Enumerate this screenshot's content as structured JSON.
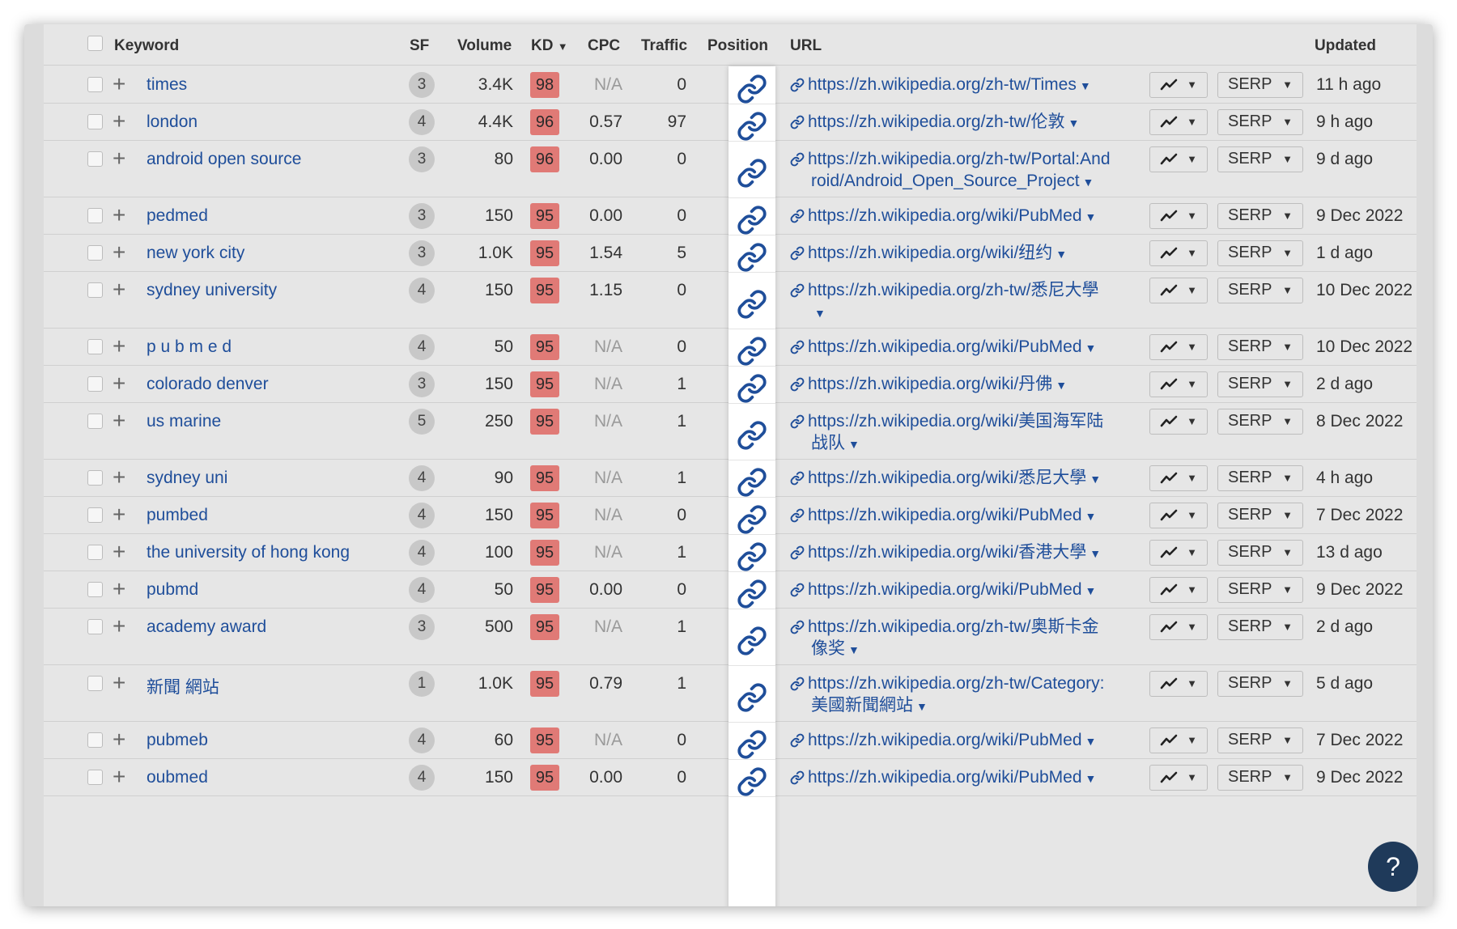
{
  "headers": {
    "keyword": "Keyword",
    "sf": "SF",
    "volume": "Volume",
    "kd": "KD",
    "cpc": "CPC",
    "traffic": "Traffic",
    "position": "Position",
    "url": "URL",
    "updated": "Updated"
  },
  "colors": {
    "kd_badge": "#e07a76",
    "link": "#1f4e9a",
    "help_button": "#1f3a5a"
  },
  "buttons": {
    "serp_label": "SERP"
  },
  "help_label": "?",
  "rows": [
    {
      "keyword": "times",
      "sf": "3",
      "volume": "3.4K",
      "kd": "98",
      "cpc": "N/A",
      "traffic": "0",
      "url": "https://zh.wikipedia.org/zh-tw/Times",
      "url_line1": "https://zh.wikipedia.org/zh-tw/Times",
      "url_line2": "",
      "updated": "11 h ago"
    },
    {
      "keyword": "london",
      "sf": "4",
      "volume": "4.4K",
      "kd": "96",
      "cpc": "0.57",
      "traffic": "97",
      "url": "https://zh.wikipedia.org/zh-tw/伦敦",
      "url_line1": "https://zh.wikipedia.org/zh-tw/伦敦",
      "url_line2": "",
      "updated": "9 h ago"
    },
    {
      "keyword": "android open source",
      "sf": "3",
      "volume": "80",
      "kd": "96",
      "cpc": "0.00",
      "traffic": "0",
      "url": "https://zh.wikipedia.org/zh-tw/Portal:Android/Android_Open_Source_Project",
      "url_line1": "https://zh.wikipedia.org/zh-tw/Portal:And",
      "url_line2": "roid/Android_Open_Source_Project",
      "updated": "9 d ago"
    },
    {
      "keyword": "pedmed",
      "sf": "3",
      "volume": "150",
      "kd": "95",
      "cpc": "0.00",
      "traffic": "0",
      "url": "https://zh.wikipedia.org/wiki/PubMed",
      "url_line1": "https://zh.wikipedia.org/wiki/PubMed",
      "url_line2": "",
      "updated": "9 Dec 2022"
    },
    {
      "keyword": "new york city",
      "sf": "3",
      "volume": "1.0K",
      "kd": "95",
      "cpc": "1.54",
      "traffic": "5",
      "url": "https://zh.wikipedia.org/wiki/纽约",
      "url_line1": "https://zh.wikipedia.org/wiki/纽约",
      "url_line2": "",
      "updated": "1 d ago"
    },
    {
      "keyword": "sydney university",
      "sf": "4",
      "volume": "150",
      "kd": "95",
      "cpc": "1.15",
      "traffic": "0",
      "url": "https://zh.wikipedia.org/zh-tw/悉尼大學",
      "url_line1": "https://zh.wikipedia.org/zh-tw/悉尼大學",
      "url_line2": "",
      "updated": "10 Dec 2022"
    },
    {
      "keyword": "p u b m e d",
      "sf": "4",
      "volume": "50",
      "kd": "95",
      "cpc": "N/A",
      "traffic": "0",
      "url": "https://zh.wikipedia.org/wiki/PubMed",
      "url_line1": "https://zh.wikipedia.org/wiki/PubMed",
      "url_line2": "",
      "updated": "10 Dec 2022"
    },
    {
      "keyword": "colorado denver",
      "sf": "3",
      "volume": "150",
      "kd": "95",
      "cpc": "N/A",
      "traffic": "1",
      "url": "https://zh.wikipedia.org/wiki/丹佛",
      "url_line1": "https://zh.wikipedia.org/wiki/丹佛",
      "url_line2": "",
      "updated": "2 d ago"
    },
    {
      "keyword": "us marine",
      "sf": "5",
      "volume": "250",
      "kd": "95",
      "cpc": "N/A",
      "traffic": "1",
      "url": "https://zh.wikipedia.org/wiki/美国海军陆战队",
      "url_line1": "https://zh.wikipedia.org/wiki/美国海军陆",
      "url_line2": "战队",
      "updated": "8 Dec 2022"
    },
    {
      "keyword": "sydney uni",
      "sf": "4",
      "volume": "90",
      "kd": "95",
      "cpc": "N/A",
      "traffic": "1",
      "url": "https://zh.wikipedia.org/wiki/悉尼大學",
      "url_line1": "https://zh.wikipedia.org/wiki/悉尼大學",
      "url_line2": "",
      "updated": "4 h ago"
    },
    {
      "keyword": "pumbed",
      "sf": "4",
      "volume": "150",
      "kd": "95",
      "cpc": "N/A",
      "traffic": "0",
      "url": "https://zh.wikipedia.org/wiki/PubMed",
      "url_line1": "https://zh.wikipedia.org/wiki/PubMed",
      "url_line2": "",
      "updated": "7 Dec 2022"
    },
    {
      "keyword": "the university of hong kong",
      "sf": "4",
      "volume": "100",
      "kd": "95",
      "cpc": "N/A",
      "traffic": "1",
      "url": "https://zh.wikipedia.org/wiki/香港大學",
      "url_line1": "https://zh.wikipedia.org/wiki/香港大學",
      "url_line2": "",
      "updated": "13 d ago"
    },
    {
      "keyword": "pubmd",
      "sf": "4",
      "volume": "50",
      "kd": "95",
      "cpc": "0.00",
      "traffic": "0",
      "url": "https://zh.wikipedia.org/wiki/PubMed",
      "url_line1": "https://zh.wikipedia.org/wiki/PubMed",
      "url_line2": "",
      "updated": "9 Dec 2022"
    },
    {
      "keyword": "academy award",
      "sf": "3",
      "volume": "500",
      "kd": "95",
      "cpc": "N/A",
      "traffic": "1",
      "url": "https://zh.wikipedia.org/zh-tw/奥斯卡金像奖",
      "url_line1": "https://zh.wikipedia.org/zh-tw/奥斯卡金",
      "url_line2": "像奖",
      "updated": "2 d ago"
    },
    {
      "keyword": "新聞 網站",
      "sf": "1",
      "volume": "1.0K",
      "kd": "95",
      "cpc": "0.79",
      "traffic": "1",
      "url": "https://zh.wikipedia.org/zh-tw/Category:美國新聞網站",
      "url_line1": "https://zh.wikipedia.org/zh-tw/Category:",
      "url_line2": "美國新聞網站",
      "updated": "5 d ago"
    },
    {
      "keyword": "pubmeb",
      "sf": "4",
      "volume": "60",
      "kd": "95",
      "cpc": "N/A",
      "traffic": "0",
      "url": "https://zh.wikipedia.org/wiki/PubMed",
      "url_line1": "https://zh.wikipedia.org/wiki/PubMed",
      "url_line2": "",
      "updated": "7 Dec 2022"
    },
    {
      "keyword": "oubmed",
      "sf": "4",
      "volume": "150",
      "kd": "95",
      "cpc": "0.00",
      "traffic": "0",
      "url": "https://zh.wikipedia.org/wiki/PubMed",
      "url_line1": "https://zh.wikipedia.org/wiki/PubMed",
      "url_line2": "",
      "updated": "9 Dec 2022"
    }
  ]
}
